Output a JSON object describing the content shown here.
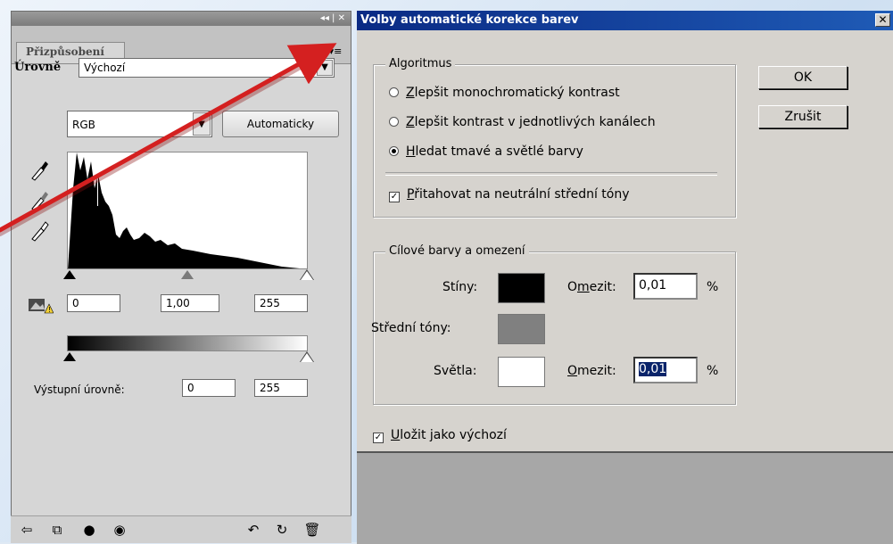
{
  "panel": {
    "title_controls": "◂◂ | ✕",
    "tab_label": "Přizpůsobení",
    "menu_icon": "panel-menu-icon",
    "levels_label": "Úrovně",
    "preset_value": "Výchozí",
    "channel_value": "RGB",
    "auto_button": "Automaticky",
    "input_black": "0",
    "input_gamma": "1,00",
    "input_white": "255",
    "output_label": "Výstupní úrovně:",
    "output_black": "0",
    "output_white": "255"
  },
  "dialog": {
    "title": "Volby automatické korekce barev",
    "close": "✕",
    "algorithm_legend": "Algoritmus",
    "algo_options": [
      {
        "pre": "Z",
        "rest": "lepšit monochromatický kontrast",
        "selected": false
      },
      {
        "pre": "Z",
        "rest": "lepšit kontrast v jednotlivých kanálech",
        "selected": false
      },
      {
        "pre": "H",
        "rest": "ledat tmavé a světlé barvy",
        "selected": true
      }
    ],
    "snap_neutral_pre": "P",
    "snap_neutral_rest": "řitahovat na neutrální střední tóny",
    "snap_neutral_checked": true,
    "targets_legend": "Cílové barvy a omezení",
    "shadows_label": "Stíny:",
    "midtones_label": "Střední tóny:",
    "highlights_label": "Světla:",
    "clip_label_a": "O",
    "clip_label_b": "m",
    "clip_label_c": "ezit:",
    "clip2_label_a": "O",
    "clip2_label_b": "mezit:",
    "shadows_clip": "0,01",
    "highlights_clip": "0,01",
    "percent": "%",
    "save_default_pre": "U",
    "save_default_rest": "ložit jako výchozí",
    "save_default_checked": true,
    "ok": "OK",
    "cancel": "Zrušit"
  },
  "colors": {
    "shadow_swatch": "#000000",
    "midtone_swatch": "#808080",
    "highlight_swatch": "#ffffff",
    "title_bar": "#0a2a84",
    "annotation_arrow": "#d42020"
  }
}
